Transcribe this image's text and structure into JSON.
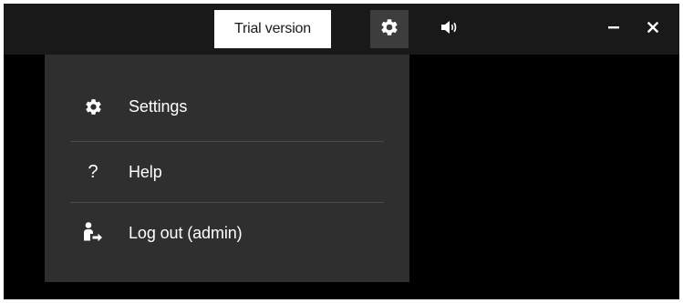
{
  "titlebar": {
    "trial_label": "Trial version",
    "icons": {
      "settings": "gear-icon",
      "volume": "speaker-icon",
      "minimize": "minimize-icon",
      "close": "close-icon"
    }
  },
  "menu": {
    "items": [
      {
        "label": "Settings",
        "icon": "gear-icon"
      },
      {
        "label": "Help",
        "icon": "question-mark-icon"
      },
      {
        "label": "Log out (admin)",
        "icon": "logout-user-icon"
      }
    ]
  },
  "colors": {
    "window_bg": "#000000",
    "titlebar_bg": "#191919",
    "menu_bg": "#2f2f2f",
    "active_button_bg": "#3d3d3d",
    "divider": "#4a4a4a",
    "text": "#ffffff"
  }
}
